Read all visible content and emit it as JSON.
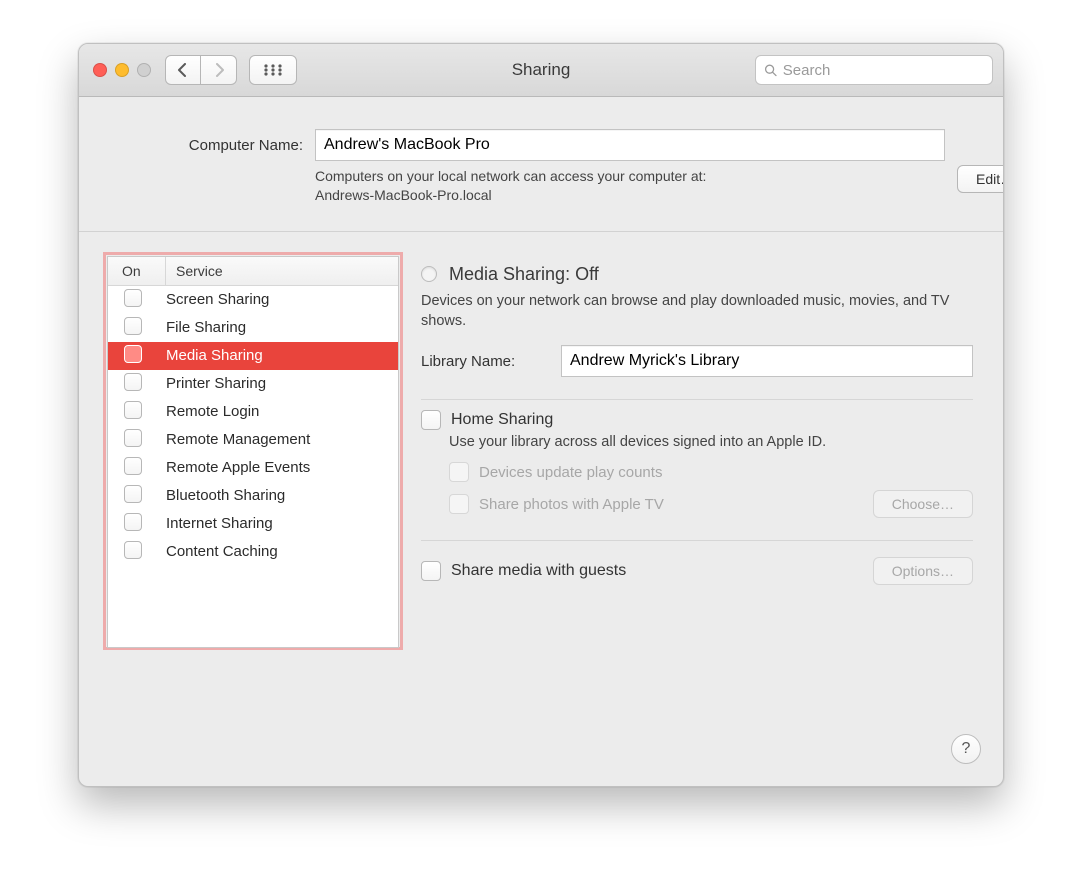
{
  "window": {
    "title": "Sharing"
  },
  "search": {
    "placeholder": "Search"
  },
  "header": {
    "computer_name_label": "Computer Name:",
    "computer_name_value": "Andrew's MacBook Pro",
    "access_text_1": "Computers on your local network can access your computer at:",
    "access_text_2": "Andrews-MacBook-Pro.local",
    "edit_label": "Edit…"
  },
  "services": {
    "col_on": "On",
    "col_service": "Service",
    "items": [
      {
        "label": "Screen Sharing",
        "selected": false
      },
      {
        "label": "File Sharing",
        "selected": false
      },
      {
        "label": "Media Sharing",
        "selected": true
      },
      {
        "label": "Printer Sharing",
        "selected": false
      },
      {
        "label": "Remote Login",
        "selected": false
      },
      {
        "label": "Remote Management",
        "selected": false
      },
      {
        "label": "Remote Apple Events",
        "selected": false
      },
      {
        "label": "Bluetooth Sharing",
        "selected": false
      },
      {
        "label": "Internet Sharing",
        "selected": false
      },
      {
        "label": "Content Caching",
        "selected": false
      }
    ]
  },
  "detail": {
    "status_title": "Media Sharing: Off",
    "description": "Devices on your network can browse and play downloaded music, movies, and TV shows.",
    "library_label": "Library Name:",
    "library_value": "Andrew Myrick's Library",
    "home_sharing_label": "Home Sharing",
    "home_sharing_desc": "Use your library across all devices signed into an Apple ID.",
    "devices_update_label": "Devices update play counts",
    "share_photos_label": "Share photos with Apple TV",
    "choose_label": "Choose…",
    "share_guests_label": "Share media with guests",
    "options_label": "Options…"
  },
  "help": {
    "label": "?"
  }
}
